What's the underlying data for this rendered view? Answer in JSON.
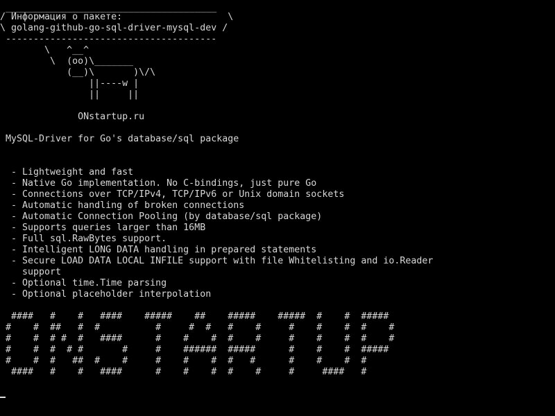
{
  "terminal": {
    "cowsay_box": {
      "top_border": " ______________________________________",
      "line1": "/ Информация о пакете:                   \\",
      "line2": "\\ golang-github-go-sql-driver-mysql-dev /",
      "bottom_border": " --------------------------------------"
    },
    "cow": [
      "        \\   ^__^",
      "         \\  (oo)\\_______",
      "            (__)\\       )\\/\\",
      "                ||----w |",
      "                ||     ||"
    ],
    "site": "              ONstartup.ru",
    "package_summary": " MySQL-Driver for Go's database/sql package",
    "features": [
      "  - Lightweight and fast",
      "  - Native Go implementation. No C-bindings, just pure Go",
      "  - Connections over TCP/IPv4, TCP/IPv6 or Unix domain sockets",
      "  - Automatic handling of broken connections",
      "  - Automatic Connection Pooling (by database/sql package)",
      "  - Supports queries larger than 16MB",
      "  - Full sql.RawBytes support.",
      "  - Intelligent LONG DATA handling in prepared statements",
      "  - Secure LOAD DATA LOCAL INFILE support with file Whitelisting and io.Reader",
      "    support",
      "  - Optional time.Time parsing",
      "  - Optional placeholder interpolation"
    ],
    "banner": [
      "  ####   #    #   ####    #####    ##    #####    #####  #    #  #####",
      " #    #  ##   #  #          #     #  #   #    #     #    #    #  #    #",
      " #    #  # #  #   ####      #    #    #  #    #     #    #    #  #    #",
      " #    #  #  # #       #     #    ######  #####      #    #    #  #####",
      " #    #  #   ##  #    #     #    #    #  #   #      #    #    #  #",
      "  ####   #    #   ####      #    #    #  #    #     #     ####   #"
    ]
  }
}
